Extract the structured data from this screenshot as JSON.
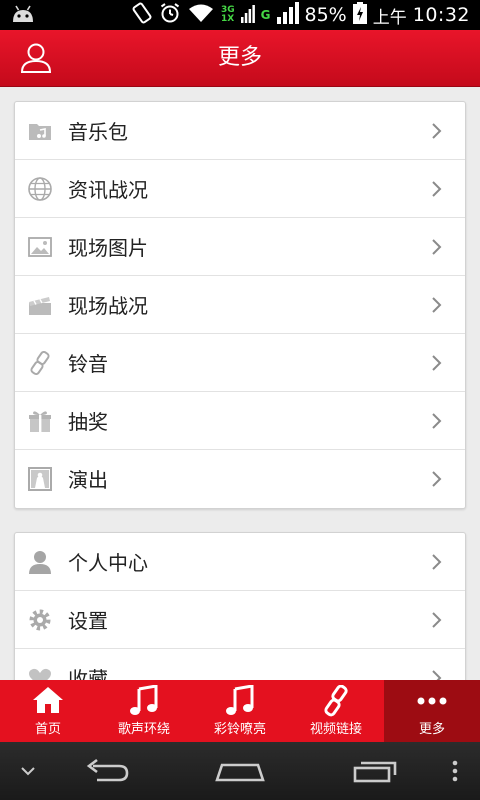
{
  "status_bar": {
    "network_top": "3G",
    "network_bottom": "1X",
    "network_g": "G",
    "battery": "85%",
    "ampm": "上午",
    "time": "10:32"
  },
  "header": {
    "title": "更多"
  },
  "menu_group_1": [
    {
      "label": "音乐包",
      "icon": "folder-music-icon"
    },
    {
      "label": "资讯战况",
      "icon": "globe-icon"
    },
    {
      "label": "现场图片",
      "icon": "image-icon"
    },
    {
      "label": "现场战况",
      "icon": "clapperboard-icon"
    },
    {
      "label": "铃音",
      "icon": "link-icon"
    },
    {
      "label": "抽奖",
      "icon": "gift-icon"
    },
    {
      "label": "演出",
      "icon": "stage-icon"
    }
  ],
  "menu_group_2": [
    {
      "label": "个人中心",
      "icon": "person-icon"
    },
    {
      "label": "设置",
      "icon": "gear-icon"
    },
    {
      "label": "收藏",
      "icon": "heart-icon"
    }
  ],
  "tabbar": [
    {
      "label": "首页",
      "icon": "home-icon"
    },
    {
      "label": "歌声环绕",
      "icon": "music-note-icon"
    },
    {
      "label": "彩铃嘹亮",
      "icon": "music-note-icon"
    },
    {
      "label": "视频链接",
      "icon": "link-icon"
    },
    {
      "label": "更多",
      "icon": "more-dots-icon",
      "active": true
    }
  ],
  "colors": {
    "accent": "#e4111f",
    "active_tab": "#9d0c12"
  }
}
